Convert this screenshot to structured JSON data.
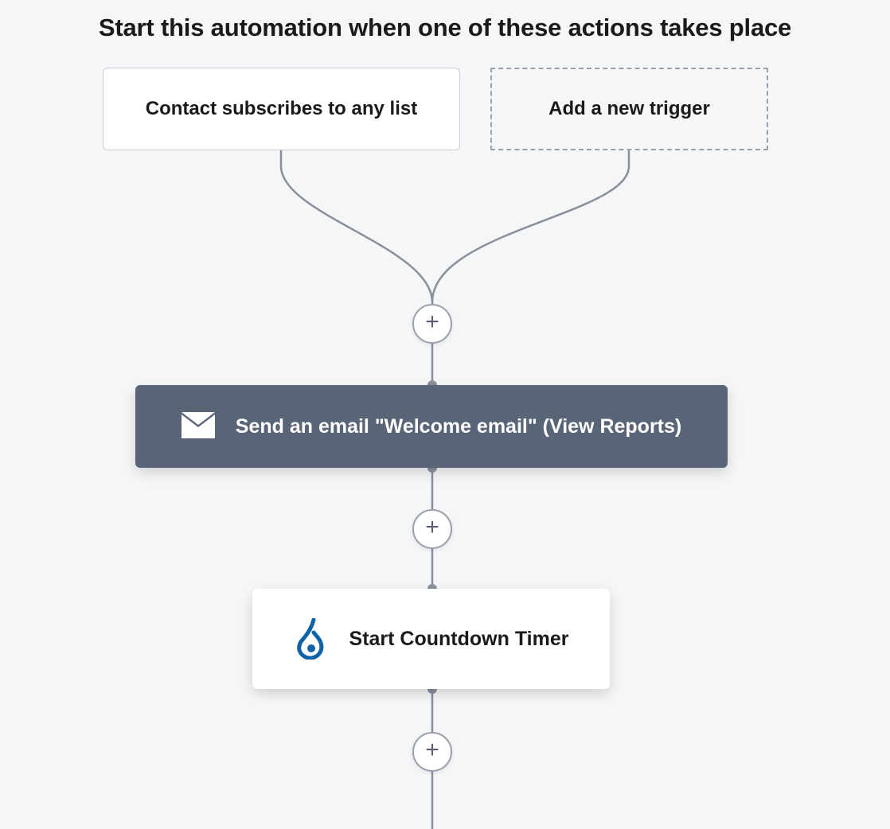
{
  "heading": "Start this automation when one of these actions takes place",
  "triggers": {
    "existing": "Contact subscribes to any list",
    "add_new": "Add a new trigger"
  },
  "steps": {
    "send_email": "Send an email \"Welcome email\" (View Reports)",
    "countdown": "Start Countdown Timer"
  },
  "plus_label": "+"
}
